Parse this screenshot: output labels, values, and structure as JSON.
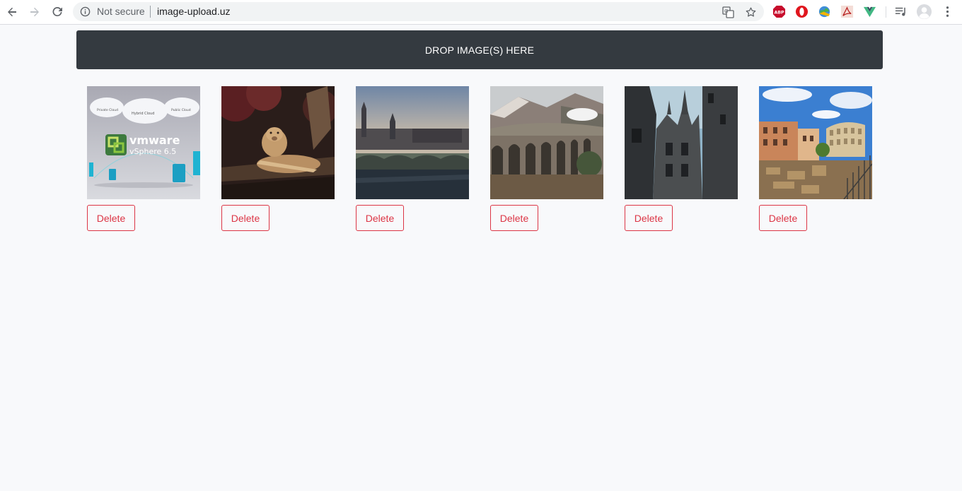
{
  "browser": {
    "security_label": "Not secure",
    "url": "image-upload.uz",
    "extensions": [
      "adblock-plus-icon",
      "opera-icon",
      "extension-globe-icon",
      "pdf-icon",
      "vue-devtools-icon"
    ]
  },
  "dropzone": {
    "label": "DROP IMAGE(S) HERE"
  },
  "images": [
    {
      "subject": "vmware-vsphere-icon",
      "delete_label": "Delete",
      "overlay": {
        "brand": "vmware",
        "product": "vSphere 6.5",
        "c1": "Private Cloud",
        "c2": "Hybrid Cloud",
        "c3": "Public Cloud"
      }
    },
    {
      "subject": "lioness-icon",
      "delete_label": "Delete"
    },
    {
      "subject": "westminster-bridge-icon",
      "delete_label": "Delete"
    },
    {
      "subject": "viaduct-train-icon",
      "delete_label": "Delete"
    },
    {
      "subject": "gothic-castle-icon",
      "delete_label": "Delete"
    },
    {
      "subject": "colosseum-icon",
      "delete_label": "Delete"
    }
  ],
  "colors": {
    "dropzone_bg": "#343a40",
    "danger": "#dc3545",
    "page_bg": "#f8f9fb"
  }
}
